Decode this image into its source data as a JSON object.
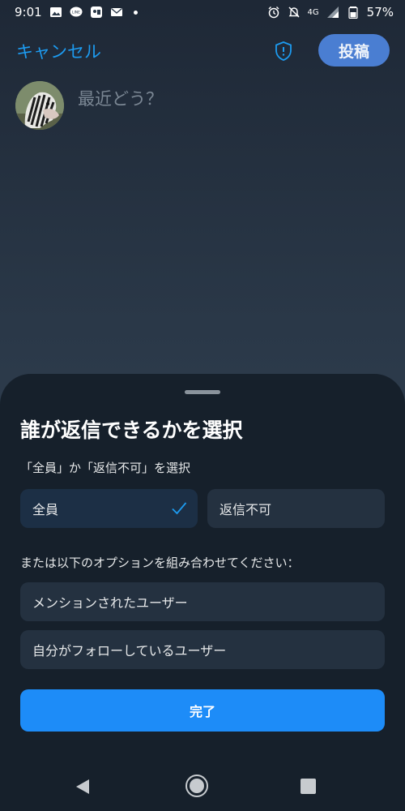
{
  "status_bar": {
    "time": "9:01",
    "network": "4G",
    "battery": "57%",
    "left_icons": [
      "image-icon",
      "line-app-icon",
      "game-app-icon",
      "mail-icon"
    ],
    "right_icons": [
      "alarm-icon",
      "mute-icon",
      "signal-icon",
      "battery-icon"
    ]
  },
  "top_bar": {
    "cancel_label": "キャンセル",
    "post_label": "投稿",
    "shield_icon": "shield-alert-icon"
  },
  "composer": {
    "placeholder": "最近どう？"
  },
  "sheet": {
    "title": "誰が返信できるかを選択",
    "subtitle": "「全員」か「返信不可」を選択",
    "options": {
      "everyone": "全員",
      "no_reply": "返信不可"
    },
    "selected": "everyone",
    "combine_label": "または以下のオプションを組み合わせてください：",
    "combinable": {
      "mentioned": "メンションされたユーザー",
      "following": "自分がフォローしているユーザー"
    },
    "done_label": "完了"
  },
  "colors": {
    "accent": "#1d9bf0",
    "done_button": "#1d8cf8",
    "post_button": "#4a7ed2",
    "sheet_bg": "#16202b",
    "option_bg": "#243140"
  }
}
